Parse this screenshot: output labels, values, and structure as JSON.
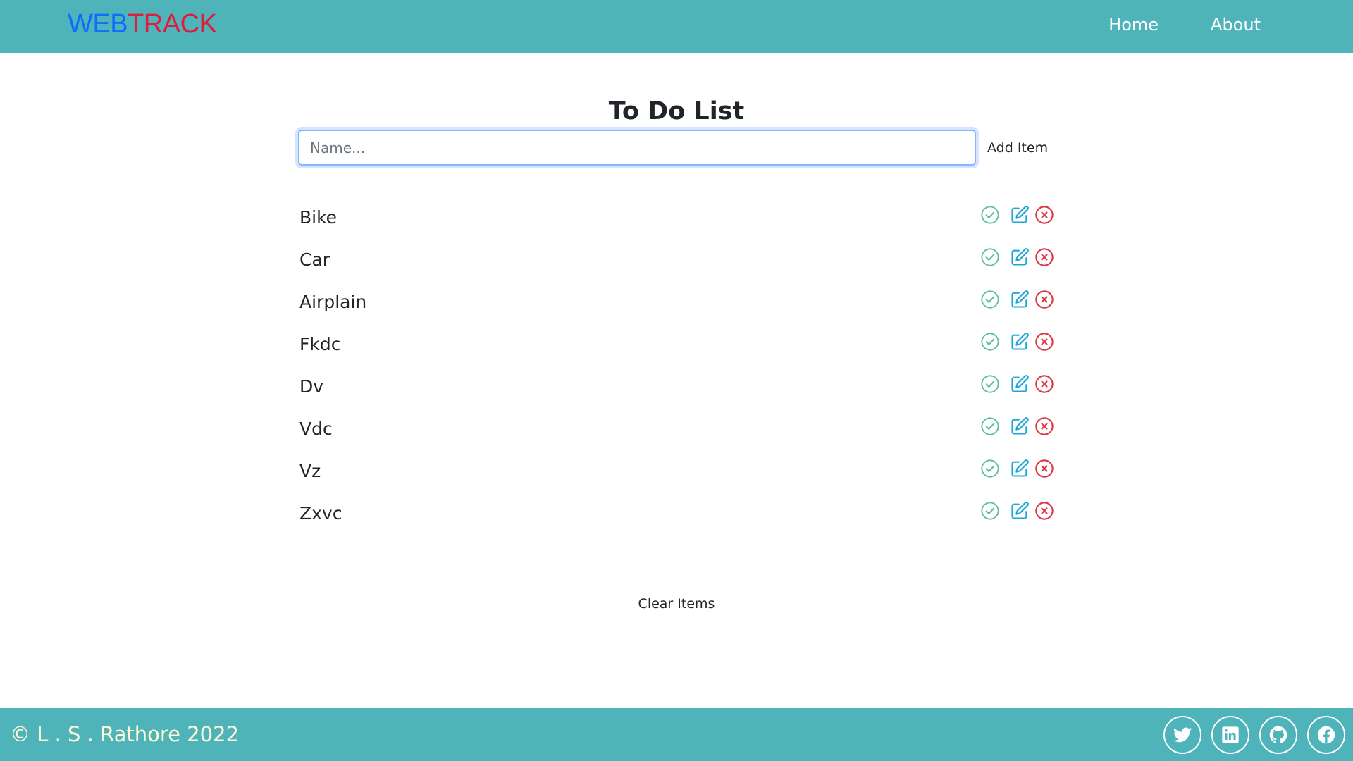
{
  "navbar": {
    "brand_part1": "WEB",
    "brand_part2": "TRACK",
    "links": [
      "Home",
      "About"
    ]
  },
  "main": {
    "title": "To Do List",
    "input_placeholder": "Name...",
    "input_value": "",
    "add_label": "Add Item",
    "items": [
      "Bike",
      "Car",
      "Airplain",
      "Fkdc",
      "Dv",
      "Vdc",
      "Vz",
      "Zxvc"
    ],
    "clear_label": "Clear Items"
  },
  "footer": {
    "copyright": "© L . S . Rathore 2022",
    "social_icons": [
      "twitter-icon",
      "linkedin-icon",
      "github-icon",
      "facebook-icon"
    ]
  },
  "colors": {
    "bar": "#4fb3ba",
    "brand_blue": "#0d6efd",
    "brand_red": "#dc1e3c",
    "done": "#5fbf95",
    "edit": "#1aa7d6",
    "delete": "#dc3545"
  }
}
